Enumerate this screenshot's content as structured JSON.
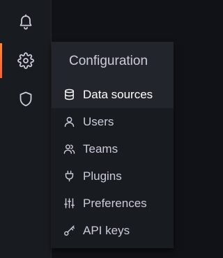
{
  "sidebar": {
    "items": [
      {
        "name": "alerting",
        "icon": "bell-icon",
        "active": false
      },
      {
        "name": "configuration",
        "icon": "gear-icon",
        "active": true
      },
      {
        "name": "server-admin",
        "icon": "shield-icon",
        "active": false
      }
    ],
    "active_color": "#ff8833"
  },
  "menu": {
    "title": "Configuration",
    "items": [
      {
        "label": "Data sources",
        "icon": "database-icon",
        "active": true
      },
      {
        "label": "Users",
        "icon": "user-icon",
        "active": false
      },
      {
        "label": "Teams",
        "icon": "users-icon",
        "active": false
      },
      {
        "label": "Plugins",
        "icon": "plug-icon",
        "active": false
      },
      {
        "label": "Preferences",
        "icon": "sliders-icon",
        "active": false
      },
      {
        "label": "API keys",
        "icon": "key-icon",
        "active": false
      }
    ]
  }
}
